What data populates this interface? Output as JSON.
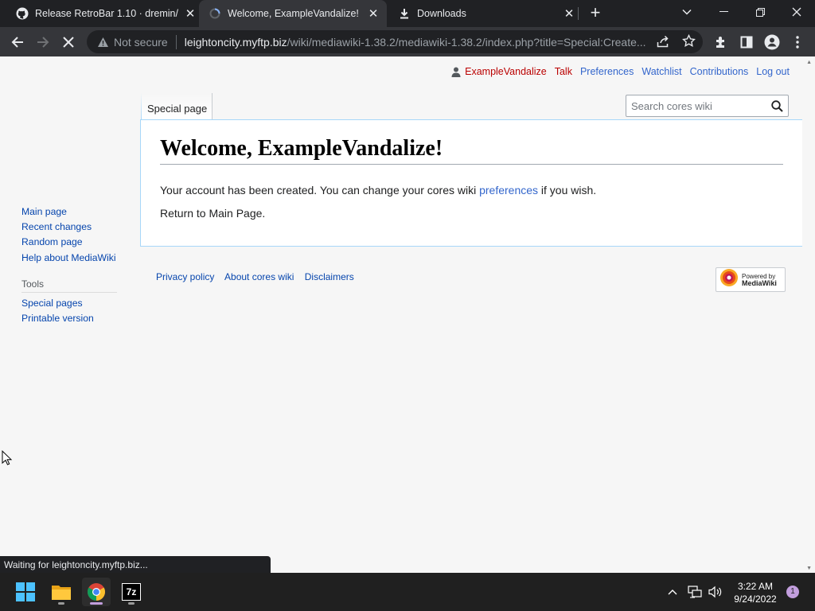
{
  "browser": {
    "tabs": [
      {
        "title": "Release RetroBar 1.10 · dremin/R",
        "icon": "github-icon",
        "active": false
      },
      {
        "title": "Welcome, ExampleVandalize! - co",
        "icon": "loading-spinner-icon",
        "active": true
      },
      {
        "title": "Downloads",
        "icon": "download-icon",
        "active": false
      }
    ],
    "new_tab_label": "+",
    "security_label": "Not secure",
    "url_host": "leightoncity.myftp.biz",
    "url_path": "/wiki/mediawiki-1.38.2/mediawiki-1.38.2/index.php?title=Special:Create...",
    "status_text": "Waiting for leightoncity.myftp.biz..."
  },
  "wiki": {
    "user_links": [
      {
        "label": "ExampleVandalize",
        "style": "red"
      },
      {
        "label": "Talk",
        "style": "red"
      },
      {
        "label": "Preferences",
        "style": "blue"
      },
      {
        "label": "Watchlist",
        "style": "blue"
      },
      {
        "label": "Contributions",
        "style": "blue"
      },
      {
        "label": "Log out",
        "style": "blue"
      }
    ],
    "namespace_tab": "Special page",
    "search_placeholder": "Search cores wiki",
    "heading": "Welcome, ExampleVandalize!",
    "body": {
      "line1_before": "Your account has been created. You can change your cores wiki ",
      "line1_link": "preferences",
      "line1_after": " if you wish.",
      "line2_before": "Return to ",
      "line2_link": "Main Page",
      "line2_after": "."
    },
    "sidebar": {
      "navigation": [
        "Main page",
        "Recent changes",
        "Random page",
        "Help about MediaWiki"
      ],
      "tools_heading": "Tools",
      "tools": [
        "Special pages",
        "Printable version"
      ]
    },
    "footer_links": [
      "Privacy policy",
      "About cores wiki",
      "Disclaimers"
    ],
    "powered_by_line1": "Powered by",
    "powered_by_line2": "MediaWiki"
  },
  "taskbar": {
    "apps": [
      "windows-start-icon",
      "file-explorer-icon",
      "chrome-icon",
      "7zip-icon"
    ],
    "sevenzip_label": "7z",
    "time": "3:22 AM",
    "date": "9/24/2022",
    "notification_count": "1"
  },
  "colors": {
    "link_blue": "#3366cc",
    "link_red": "#ba0000",
    "chrome_dark": "#202124",
    "chrome_toolbar": "#35363a",
    "taskbar": "#202020"
  }
}
